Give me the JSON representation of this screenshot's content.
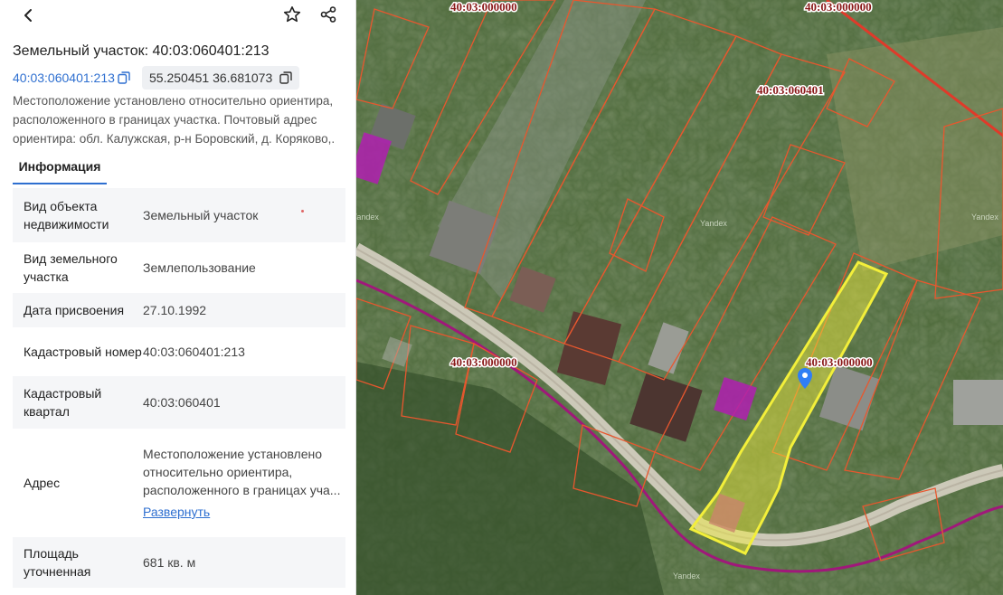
{
  "header": {
    "title": "Земельный участок: 40:03:060401:213"
  },
  "cadastral_link": "40:03:060401:213",
  "coordinates": "55.250451 36.681073",
  "description": "Местоположение установлено относительно ориентира, расположенного в границах участка. Почтовый адрес ориентира: обл. Калужская, р-н Боровский, д. Коряково,.",
  "tabs": [
    {
      "label": "Информация",
      "active": true
    }
  ],
  "info": {
    "object_type": {
      "key": "Вид объекта недвижимости",
      "value": "Земельный участок"
    },
    "land_type": {
      "key": "Вид земельного участка",
      "value": "Землепользование"
    },
    "date": {
      "key": "Дата присвоения",
      "value": "27.10.1992"
    },
    "cad_number": {
      "key": "Кадастровый номер",
      "value": "40:03:060401:213"
    },
    "cad_quarter": {
      "key": "Кадастровый квартал",
      "value": "40:03:060401"
    },
    "address": {
      "key": "Адрес",
      "value": "Местоположение установлено относительно ориентира, расположенного в границах уча...",
      "expand": "Развернуть"
    },
    "area": {
      "key": "Площадь уточненная",
      "value": "681 кв. м"
    }
  },
  "map": {
    "labels": [
      "40:03:000000",
      "40:03:000000",
      "40:03:060401",
      "40:03:000000",
      "40:03:000000"
    ],
    "watermark": "Yandex",
    "colors": {
      "parcel_border": "#e8572e",
      "selected_fill": "#f3ef3a",
      "highlight": "#b01fb0",
      "road": "#e8e4da",
      "boundary": "#a0187a"
    }
  },
  "icons": [
    "back-icon",
    "star-icon",
    "share-icon",
    "copy-icon",
    "map-pin-icon"
  ]
}
